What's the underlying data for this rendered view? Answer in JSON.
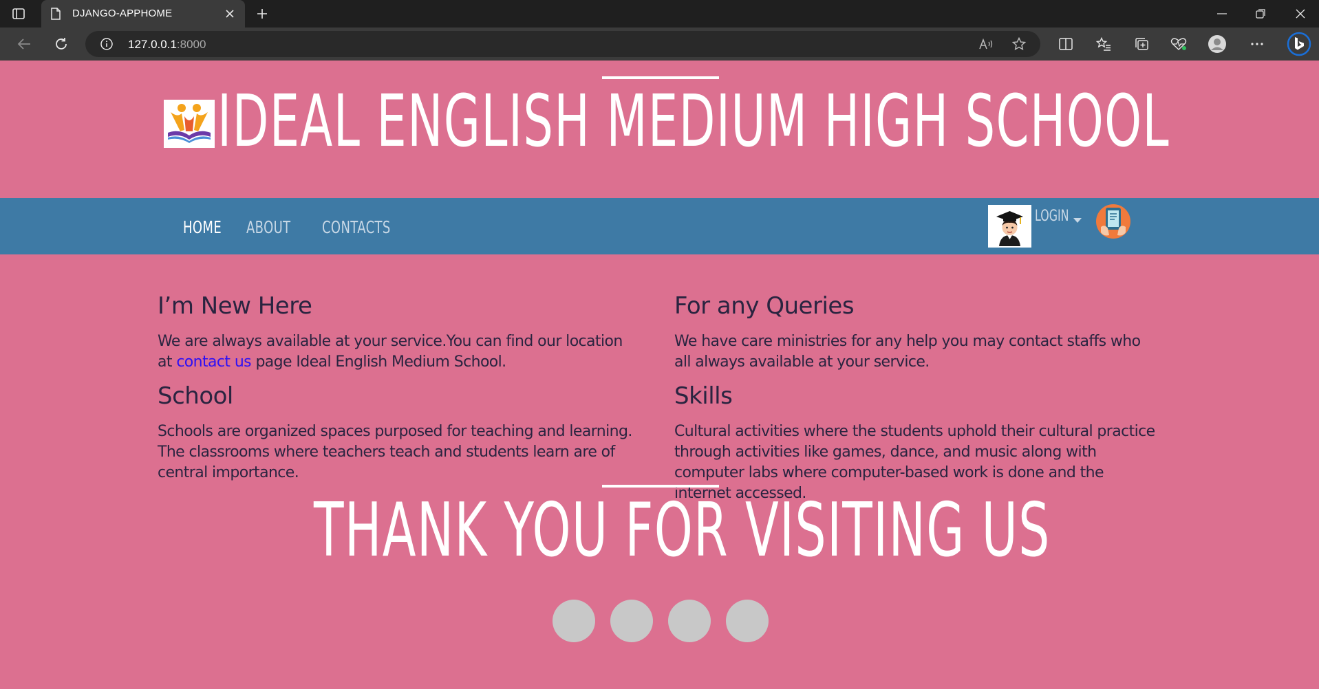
{
  "browser": {
    "tab_title": "DJANGO-APPHOME",
    "url_host": "127.0.0.1",
    "url_port": ":8000"
  },
  "site": {
    "title": "IDEAL ENGLISH MEDIUM HIGH SCHOOL",
    "nav": [
      {
        "label": "HOME",
        "active": true
      },
      {
        "label": "ABOUT",
        "active": false
      },
      {
        "label": "CONTACTS",
        "active": false
      }
    ],
    "login_label": "LOGIN"
  },
  "sections": {
    "new_here": {
      "heading": "I’m New Here",
      "text_before_link": "We are always available at your service.You can find our location at ",
      "link_text": "contact us",
      "text_after_link": " page Ideal English Medium School."
    },
    "queries": {
      "heading": "For any Queries",
      "text": "We have care ministries for any help you may contact staffs who all always available at your service."
    },
    "school": {
      "heading": "School",
      "text": "Schools are organized spaces purposed for teaching and learning. The classrooms where teachers teach and students learn are of central importance."
    },
    "skills": {
      "heading": "Skills",
      "text": "Cultural activities where the students uphold their cultural practice through activities like games, dance, and music along with computer labs where computer-based work is done and the internet accessed."
    }
  },
  "footer": {
    "thanks": "THANK YOU FOR VISITING US",
    "social_icon_count": 4
  },
  "colors": {
    "page_bg": "#dc7090",
    "navbar_bg": "#3e7aa5",
    "link": "#2e10f5",
    "heading_text": "#2a2440",
    "social_circle": "#c8c8c8"
  }
}
